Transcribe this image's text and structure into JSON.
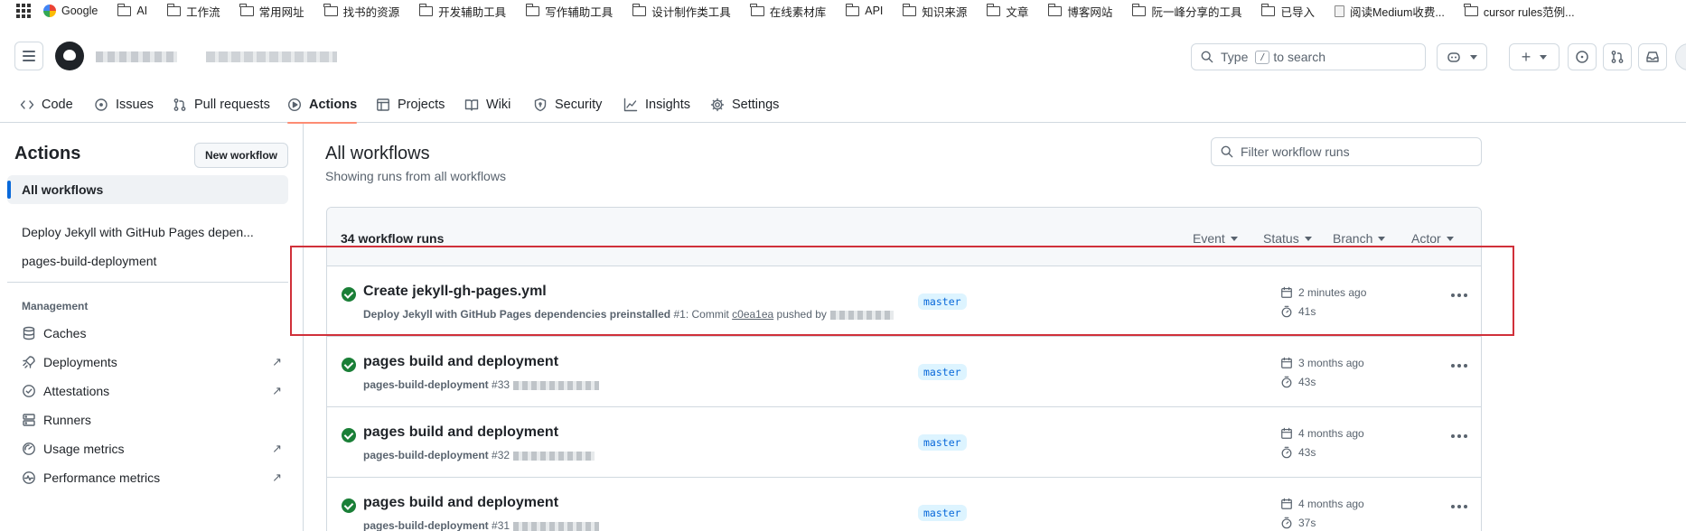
{
  "bookmarks": [
    {
      "label": "Google",
      "icon": "google-icon"
    },
    {
      "label": "AI",
      "icon": "folder-icon"
    },
    {
      "label": "工作流",
      "icon": "folder-icon"
    },
    {
      "label": "常用网址",
      "icon": "folder-icon"
    },
    {
      "label": "找书的资源",
      "icon": "folder-icon"
    },
    {
      "label": "开发辅助工具",
      "icon": "folder-icon"
    },
    {
      "label": "写作辅助工具",
      "icon": "folder-icon"
    },
    {
      "label": "设计制作类工具",
      "icon": "folder-icon"
    },
    {
      "label": "在线素材库",
      "icon": "folder-icon"
    },
    {
      "label": "API",
      "icon": "folder-icon"
    },
    {
      "label": "知识来源",
      "icon": "folder-icon"
    },
    {
      "label": "文章",
      "icon": "folder-icon"
    },
    {
      "label": "博客网站",
      "icon": "folder-icon"
    },
    {
      "label": "阮一峰分享的工具",
      "icon": "folder-icon"
    },
    {
      "label": "已导入",
      "icon": "folder-icon"
    },
    {
      "label": "阅读Medium收费...",
      "icon": "page-icon"
    },
    {
      "label": "cursor rules范例...",
      "icon": "folder-icon"
    }
  ],
  "header": {
    "search_placeholder_pre": "Type",
    "search_key": "/",
    "search_placeholder_post": "to search"
  },
  "repo_nav": {
    "tabs": [
      {
        "label": "Code",
        "icon": "code-icon"
      },
      {
        "label": "Issues",
        "icon": "issue-opened-icon"
      },
      {
        "label": "Pull requests",
        "icon": "git-pull-request-icon"
      },
      {
        "label": "Actions",
        "icon": "play-icon",
        "active": true
      },
      {
        "label": "Projects",
        "icon": "table-icon"
      },
      {
        "label": "Wiki",
        "icon": "book-icon"
      },
      {
        "label": "Security",
        "icon": "shield-icon"
      },
      {
        "label": "Insights",
        "icon": "graph-icon"
      },
      {
        "label": "Settings",
        "icon": "gear-icon"
      }
    ]
  },
  "sidebar": {
    "title": "Actions",
    "new_workflow": "New workflow",
    "all_workflows": "All workflows",
    "workflows": [
      "Deploy Jekyll with GitHub Pages depen...",
      "pages-build-deployment"
    ],
    "management_label": "Management",
    "management": [
      {
        "label": "Caches",
        "icon": "database-icon",
        "external": false
      },
      {
        "label": "Deployments",
        "icon": "rocket-icon",
        "external": true
      },
      {
        "label": "Attestations",
        "icon": "verified-icon",
        "external": true
      },
      {
        "label": "Runners",
        "icon": "server-icon",
        "external": false
      },
      {
        "label": "Usage metrics",
        "icon": "meter-icon",
        "external": true
      },
      {
        "label": "Performance metrics",
        "icon": "pulse-icon",
        "external": true
      }
    ],
    "external_glyph": "↗"
  },
  "main": {
    "title": "All workflows",
    "subtitle": "Showing runs from all workflows",
    "filter_placeholder": "Filter workflow runs",
    "runs_count": "34 workflow runs",
    "filters": [
      "Event",
      "Status",
      "Branch",
      "Actor"
    ],
    "runs": [
      {
        "title": "Create jekyll-gh-pages.yml",
        "workflow": "Deploy Jekyll with GitHub Pages dependencies preinstalled",
        "number": "#1",
        "detail_prefix": ": Commit ",
        "commit": "c0ea1ea",
        "detail_suffix": " pushed by",
        "branch": "master",
        "time": "2 minutes ago",
        "duration": "41s",
        "status": "success"
      },
      {
        "title": "pages build and deployment",
        "workflow": "pages-build-deployment",
        "number": "#33",
        "detail_prefix": "",
        "commit": "",
        "detail_suffix": "",
        "branch": "master",
        "time": "3 months ago",
        "duration": "43s",
        "status": "success"
      },
      {
        "title": "pages build and deployment",
        "workflow": "pages-build-deployment",
        "number": "#32",
        "detail_prefix": "",
        "commit": "",
        "detail_suffix": "",
        "branch": "master",
        "time": "4 months ago",
        "duration": "43s",
        "status": "success"
      },
      {
        "title": "pages build and deployment",
        "workflow": "pages-build-deployment",
        "number": "#31",
        "detail_prefix": "",
        "commit": "",
        "detail_suffix": "",
        "branch": "master",
        "time": "4 months ago",
        "duration": "37s",
        "status": "success"
      }
    ]
  },
  "colors": {
    "accent": "#0969da",
    "success": "#1a7f37",
    "tab_underline": "#fd8c73",
    "highlight_box": "#d0303a"
  }
}
